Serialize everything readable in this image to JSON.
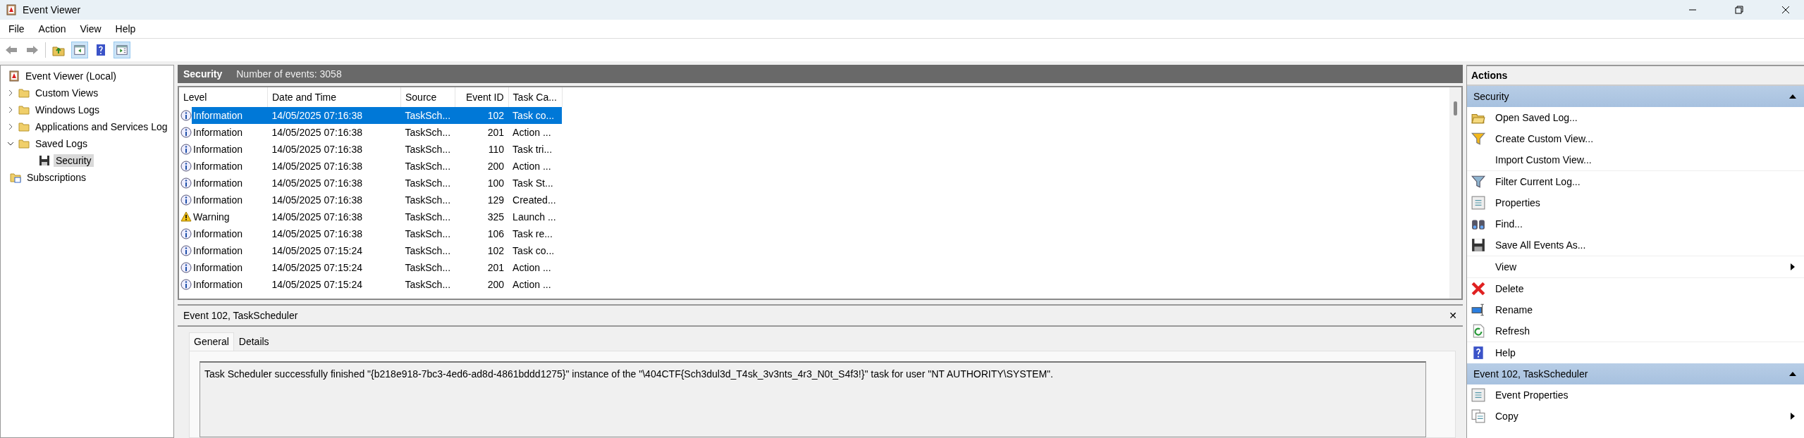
{
  "window": {
    "title": "Event Viewer"
  },
  "menu": [
    "File",
    "Action",
    "View",
    "Help"
  ],
  "tree": [
    {
      "label": "Event Viewer (Local)",
      "kind": "root",
      "children": [
        {
          "label": "Custom Views",
          "kind": "folder",
          "expanded": false
        },
        {
          "label": "Windows Logs",
          "kind": "folder",
          "expanded": false
        },
        {
          "label": "Applications and Services Log",
          "kind": "folder",
          "expanded": false
        },
        {
          "label": "Saved Logs",
          "kind": "folder",
          "expanded": true,
          "children": [
            {
              "label": "Security",
              "kind": "log",
              "selected": true
            }
          ]
        },
        {
          "label": "Subscriptions",
          "kind": "subscriptions"
        }
      ]
    }
  ],
  "log_header": {
    "name": "Security",
    "count": "Number of events: 3058"
  },
  "table": {
    "columns": [
      "Level",
      "Date and Time",
      "Source",
      "Event ID",
      "Task Ca..."
    ],
    "rows": [
      {
        "kind": "information",
        "level": "Information",
        "date": "14/05/2025 07:16:38",
        "source": "TaskSch...",
        "event_id": "102",
        "task": "Task co...",
        "selected": true
      },
      {
        "kind": "information",
        "level": "Information",
        "date": "14/05/2025 07:16:38",
        "source": "TaskSch...",
        "event_id": "201",
        "task": "Action ...",
        "selected": false
      },
      {
        "kind": "information",
        "level": "Information",
        "date": "14/05/2025 07:16:38",
        "source": "TaskSch...",
        "event_id": "110",
        "task": "Task tri...",
        "selected": false
      },
      {
        "kind": "information",
        "level": "Information",
        "date": "14/05/2025 07:16:38",
        "source": "TaskSch...",
        "event_id": "200",
        "task": "Action ...",
        "selected": false
      },
      {
        "kind": "information",
        "level": "Information",
        "date": "14/05/2025 07:16:38",
        "source": "TaskSch...",
        "event_id": "100",
        "task": "Task St...",
        "selected": false
      },
      {
        "kind": "information",
        "level": "Information",
        "date": "14/05/2025 07:16:38",
        "source": "TaskSch...",
        "event_id": "129",
        "task": "Created...",
        "selected": false
      },
      {
        "kind": "warning",
        "level": "Warning",
        "date": "14/05/2025 07:16:38",
        "source": "TaskSch...",
        "event_id": "325",
        "task": "Launch ...",
        "selected": false
      },
      {
        "kind": "information",
        "level": "Information",
        "date": "14/05/2025 07:16:38",
        "source": "TaskSch...",
        "event_id": "106",
        "task": "Task re...",
        "selected": false
      },
      {
        "kind": "information",
        "level": "Information",
        "date": "14/05/2025 07:15:24",
        "source": "TaskSch...",
        "event_id": "102",
        "task": "Task co...",
        "selected": false
      },
      {
        "kind": "information",
        "level": "Information",
        "date": "14/05/2025 07:15:24",
        "source": "TaskSch...",
        "event_id": "201",
        "task": "Action ...",
        "selected": false
      },
      {
        "kind": "information",
        "level": "Information",
        "date": "14/05/2025 07:15:24",
        "source": "TaskSch...",
        "event_id": "200",
        "task": "Action ...",
        "selected": false
      }
    ]
  },
  "detail": {
    "title": "Event 102, TaskScheduler",
    "close": "✕",
    "tabs": [
      {
        "label": "General",
        "selected": true
      },
      {
        "label": "Details",
        "selected": false
      }
    ],
    "message": "Task Scheduler successfully finished \"{b218e918-7bc3-4ed6-ad8d-4861bddd1275}\" instance of the \"\\404CTF{Sch3dul3d_T4sk_3v3nts_4r3_N0t_S4f3!}\" task for user \"NT AUTHORITY\\SYSTEM\"."
  },
  "actions": {
    "title": "Actions",
    "groups": [
      {
        "title": "Security",
        "expanded": true,
        "items": [
          {
            "label": "Open Saved Log...",
            "kind": "open"
          },
          {
            "label": "Create Custom View...",
            "kind": "create"
          },
          {
            "label": "Import Custom View...",
            "kind": "import",
            "divider": true
          },
          {
            "label": "Filter Current Log...",
            "kind": "filter"
          },
          {
            "label": "Properties",
            "kind": "properties"
          },
          {
            "label": "Find...",
            "kind": "find"
          },
          {
            "label": "Save All Events As...",
            "kind": "save",
            "divider": true
          },
          {
            "label": "View",
            "kind": "view",
            "submenu": true,
            "divider": true
          },
          {
            "label": "Delete",
            "kind": "delete"
          },
          {
            "label": "Rename",
            "kind": "rename"
          },
          {
            "label": "Refresh",
            "kind": "refresh",
            "divider": true
          },
          {
            "label": "Help",
            "kind": "help"
          }
        ]
      },
      {
        "title": "Event 102, TaskScheduler",
        "expanded": true,
        "items": [
          {
            "label": "Event Properties",
            "kind": "properties"
          },
          {
            "label": "Copy",
            "kind": "copy",
            "submenu": true
          }
        ]
      }
    ]
  }
}
